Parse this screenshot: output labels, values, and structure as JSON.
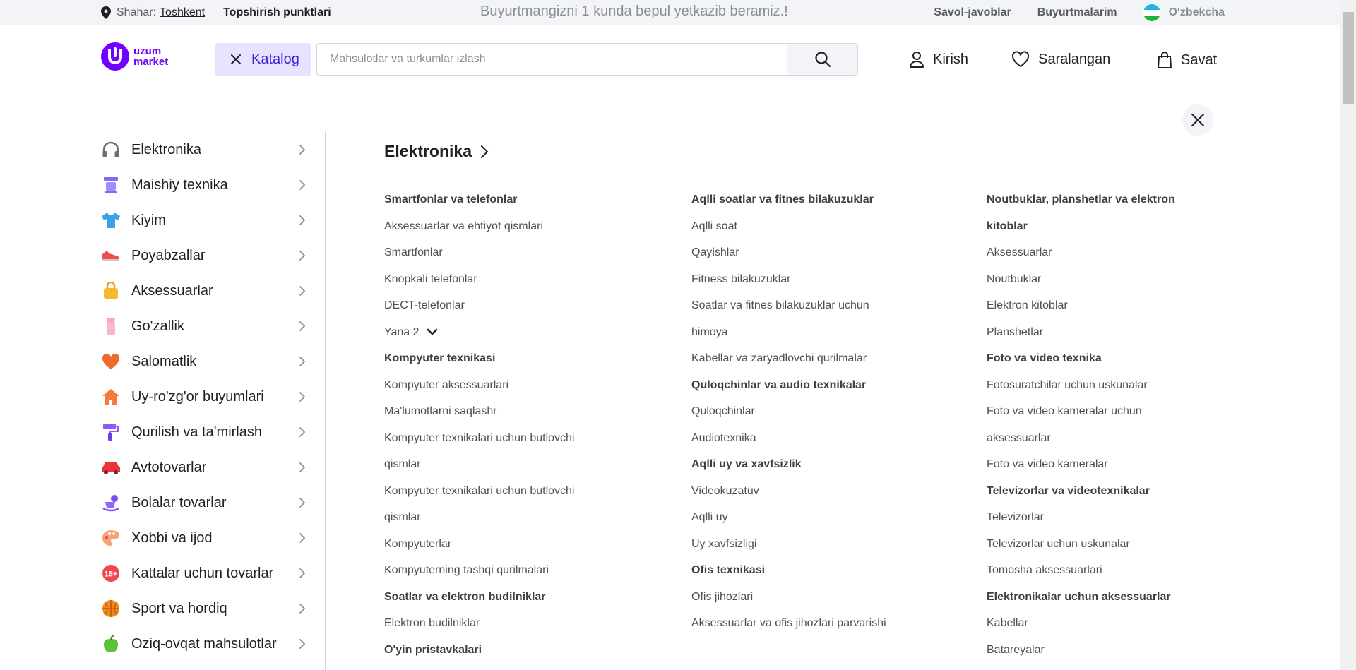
{
  "topbar": {
    "city_label": "Shahar:",
    "city_name": "Toshkent",
    "pickup": "Topshirish punktlari",
    "promo": "Buyurtmangizni 1 kunda bepul yetkazib beramiz.!",
    "faq": "Savol-javoblar",
    "orders": "Buyurtmalarim",
    "language": "O'zbekcha"
  },
  "header": {
    "logo_line1": "uzum",
    "logo_line2": "market",
    "katalog": "Katalog",
    "search_placeholder": "Mahsulotlar va turkumlar izlash",
    "login": "Kirish",
    "favorites": "Saralangan",
    "cart": "Savat"
  },
  "sidebar": {
    "items": [
      {
        "label": "Elektronika",
        "icon": "headphones-icon"
      },
      {
        "label": "Maishiy texnika",
        "icon": "appliance-icon"
      },
      {
        "label": "Kiyim",
        "icon": "tshirt-icon"
      },
      {
        "label": "Poyabzallar",
        "icon": "sneaker-icon"
      },
      {
        "label": "Aksessuarlar",
        "icon": "bag-icon"
      },
      {
        "label": "Go'zallik",
        "icon": "lipstick-icon"
      },
      {
        "label": "Salomatlik",
        "icon": "heart-icon"
      },
      {
        "label": "Uy-ro'zg'or buyumlari",
        "icon": "house-icon"
      },
      {
        "label": "Qurilish va ta'mirlash",
        "icon": "paint-roller-icon"
      },
      {
        "label": "Avtotovarlar",
        "icon": "car-icon"
      },
      {
        "label": "Bolalar tovarlar",
        "icon": "rocking-horse-icon"
      },
      {
        "label": "Xobbi va ijod",
        "icon": "palette-icon"
      },
      {
        "label": "Kattalar uchun tovarlar",
        "icon": "adult-18-icon"
      },
      {
        "label": "Sport va hordiq",
        "icon": "ball-icon"
      },
      {
        "label": "Oziq-ovqat mahsulotlar",
        "icon": "apple-icon"
      }
    ]
  },
  "content": {
    "title": "Elektronika",
    "col1": [
      {
        "t": "Smartfonlar va telefonlar",
        "h": true
      },
      {
        "t": "Aksessuarlar va ehtiyot qismlari"
      },
      {
        "t": "Smartfonlar"
      },
      {
        "t": "Knopkali telefonlar"
      },
      {
        "t": "DECT-telefonlar"
      },
      {
        "t": "Yana 2",
        "more": true
      },
      {
        "t": "Kompyuter texnikasi",
        "h": true
      },
      {
        "t": "Kompyuter aksessuarlari"
      },
      {
        "t": "Ma'lumotlarni saqlashr"
      },
      {
        "t": "Kompyuter texnikalari uchun butlovchi"
      },
      {
        "t": "qismlar"
      },
      {
        "t": "Kompyuter texnikalari uchun butlovchi"
      },
      {
        "t": "qismlar"
      },
      {
        "t": "Kompyuterlar"
      },
      {
        "t": "Kompyuterning tashqi qurilmalari"
      },
      {
        "t": "Soatlar va elektron budilniklar",
        "h": true
      },
      {
        "t": "Elektron budilniklar"
      },
      {
        "t": "O'yin pristavkalari",
        "h": true
      }
    ],
    "col2": [
      {
        "t": "Aqlli soatlar va fitnes bilakuzuklar",
        "h": true
      },
      {
        "t": "Aqlli soat"
      },
      {
        "t": "Qayishlar"
      },
      {
        "t": "Fitness bilakuzuklar"
      },
      {
        "t": "Soatlar va fitnes bilakuzuklar uchun"
      },
      {
        "t": "himoya"
      },
      {
        "t": "Kabellar va zaryadlovchi qurilmalar"
      },
      {
        "t": "Quloqchinlar va audio texnikalar",
        "h": true
      },
      {
        "t": "Quloqchinlar"
      },
      {
        "t": "Audiotexnika"
      },
      {
        "t": "Aqlli uy va xavfsizlik",
        "h": true
      },
      {
        "t": "Videokuzatuv"
      },
      {
        "t": "Aqlli uy"
      },
      {
        "t": "Uy xavfsizligi"
      },
      {
        "t": "Ofis texnikasi",
        "h": true
      },
      {
        "t": "Ofis jihozlari"
      },
      {
        "t": "Aksessuarlar va ofis jihozlari parvarishi"
      }
    ],
    "col3": [
      {
        "t": "Noutbuklar, planshetlar va elektron",
        "h": true
      },
      {
        "t": "kitoblar",
        "h": true
      },
      {
        "t": "Aksessuarlar"
      },
      {
        "t": "Noutbuklar"
      },
      {
        "t": "Elektron kitoblar"
      },
      {
        "t": "Planshetlar"
      },
      {
        "t": "Foto va video texnika",
        "h": true
      },
      {
        "t": "Fotosuratchilar uchun uskunalar"
      },
      {
        "t": "Foto va video kameralar uchun"
      },
      {
        "t": "aksessuarlar"
      },
      {
        "t": "Foto va video kameralar"
      },
      {
        "t": "Televizorlar va videotexnikalar",
        "h": true
      },
      {
        "t": "Televizorlar"
      },
      {
        "t": "Televizorlar uchun uskunalar"
      },
      {
        "t": "Tomosha aksessuarlari"
      },
      {
        "t": "Elektronikalar uchun aksessuarlar",
        "h": true
      },
      {
        "t": "Kabellar"
      },
      {
        "t": "Batareyalar"
      }
    ]
  },
  "colors": {
    "brand": "#7000ff",
    "katalog_bg": "#e5e3ff",
    "katalog_text": "#3c1ddc",
    "topbar_bg": "#f2f4f7"
  }
}
